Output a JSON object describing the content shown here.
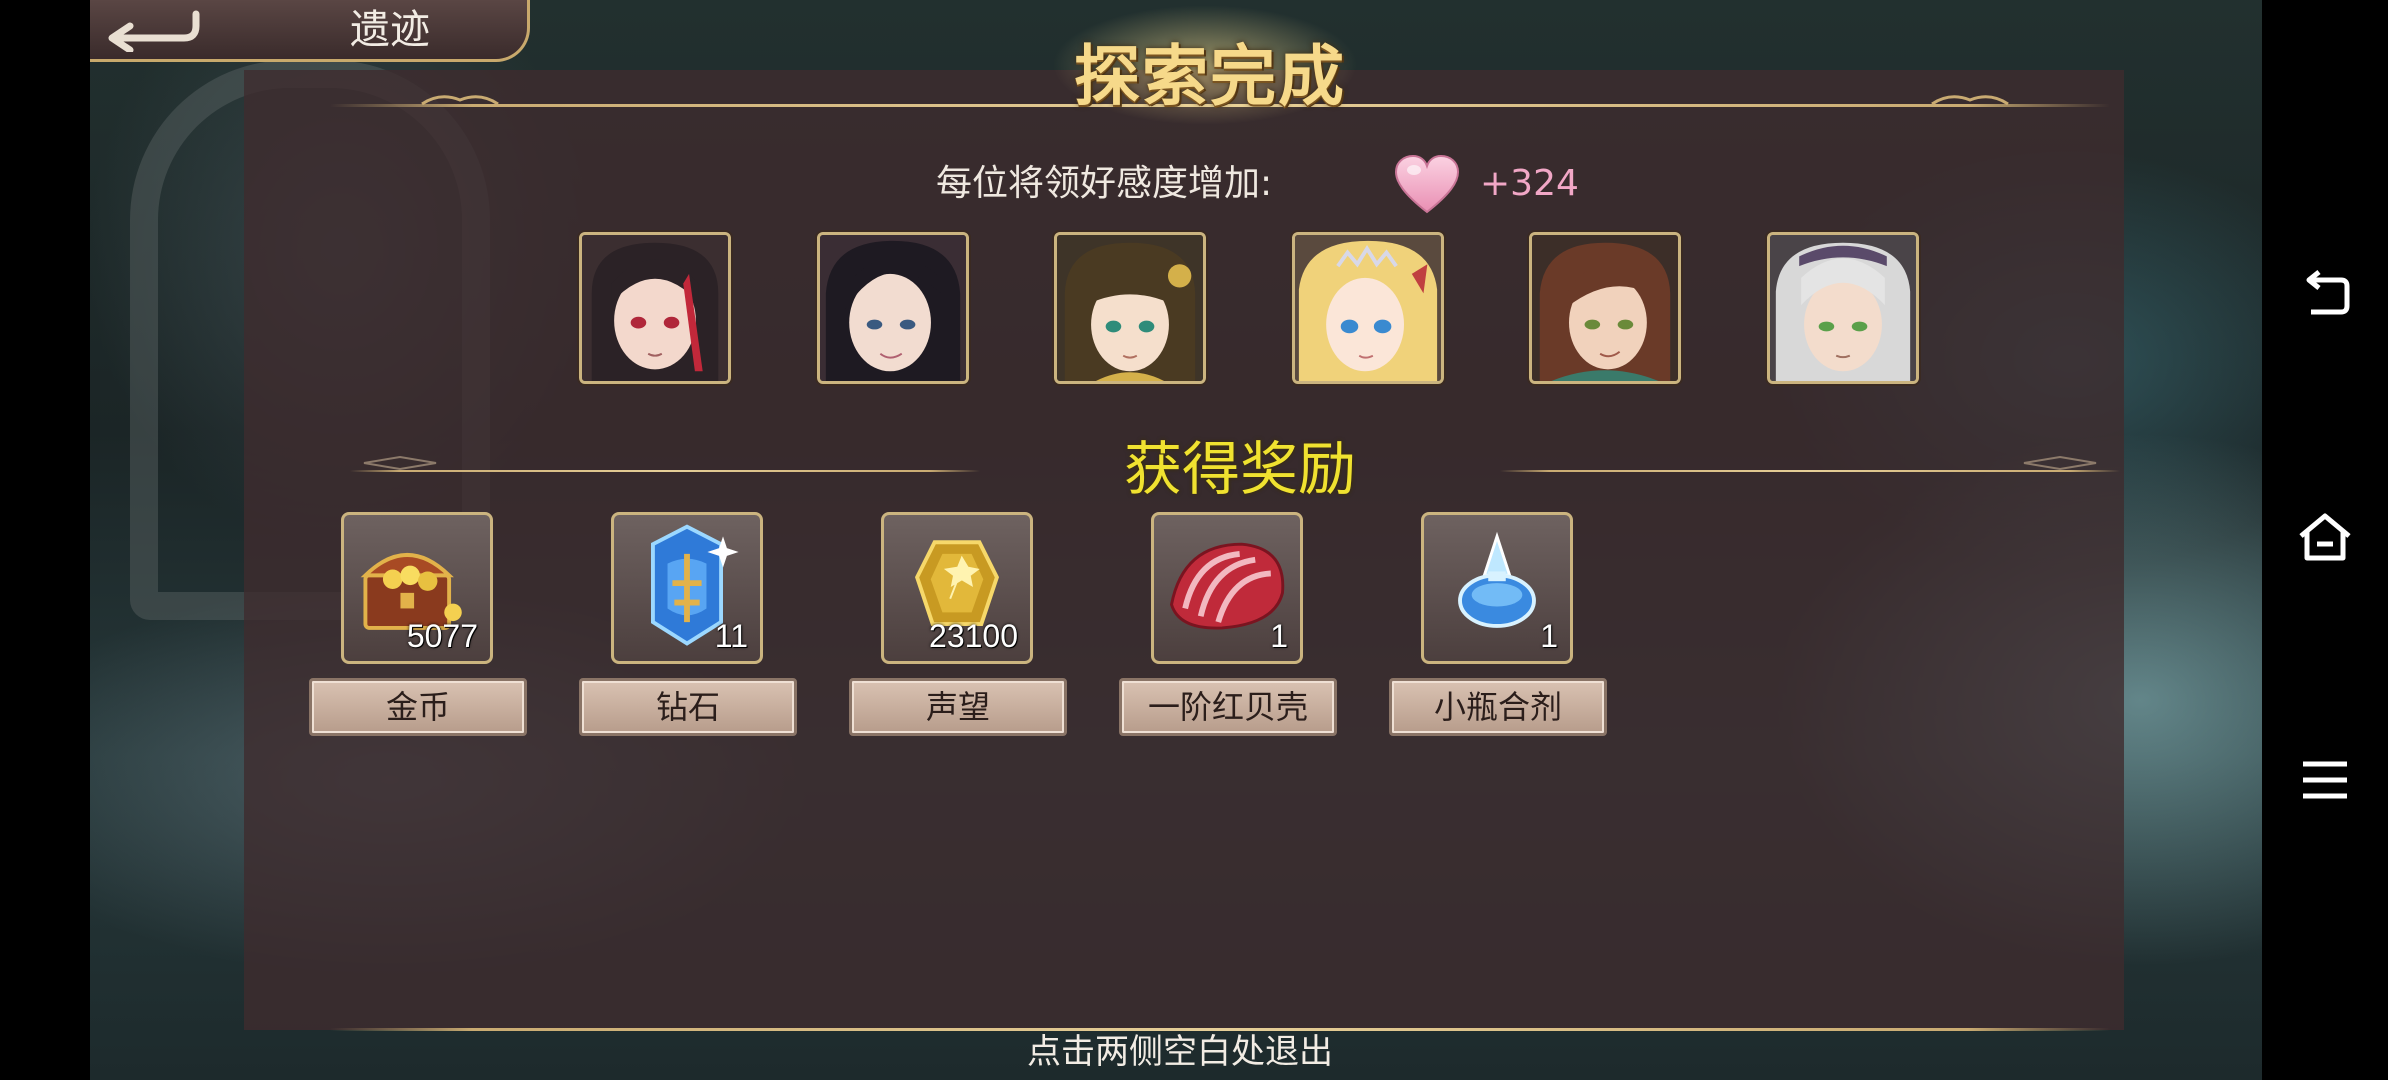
{
  "header": {
    "title": "遗迹",
    "banner": "探索完成"
  },
  "affection": {
    "label": "每位将领好感度增加:",
    "value": "+324",
    "icon": "heart-icon",
    "color": "#f1a7c6"
  },
  "portraits": [
    {
      "name": "general-portrait-1",
      "hair": "#2b2226",
      "accent": "#c2283a",
      "eyes": "#b0273a"
    },
    {
      "name": "general-portrait-2",
      "hair": "#1e1a22",
      "accent": "#2c2530",
      "eyes": "#3a5a80"
    },
    {
      "name": "general-portrait-3",
      "hair": "#4a3a22",
      "accent": "#d4b04a",
      "eyes": "#2f8c7a"
    },
    {
      "name": "general-portrait-4",
      "hair": "#f0d27a",
      "accent": "#d8d8e8",
      "eyes": "#3a8ad0"
    },
    {
      "name": "general-portrait-5",
      "hair": "#6a3a28",
      "accent": "#3a7a6a",
      "eyes": "#6a8a3a"
    },
    {
      "name": "general-portrait-6",
      "hair": "#d8d8d8",
      "accent": "#5a4a6a",
      "eyes": "#5aa04a"
    }
  ],
  "rewards": {
    "title": "获得奖励",
    "items": [
      {
        "name": "金币",
        "count": "5077",
        "icon": "treasure-chest-icon"
      },
      {
        "name": "钻石",
        "count": "11",
        "icon": "diamond-crystal-icon"
      },
      {
        "name": "声望",
        "count": "23100",
        "icon": "prestige-medal-icon"
      },
      {
        "name": "一阶红贝壳",
        "count": "1",
        "icon": "red-shell-icon"
      },
      {
        "name": "小瓶合剂",
        "count": "1",
        "icon": "potion-bottle-icon"
      }
    ]
  },
  "footer": {
    "hint": "点击两侧空白处退出"
  },
  "colors": {
    "gold": "#c9ab72",
    "rewards_title": "#f0e230",
    "label_bg": "#d9c2b2"
  }
}
